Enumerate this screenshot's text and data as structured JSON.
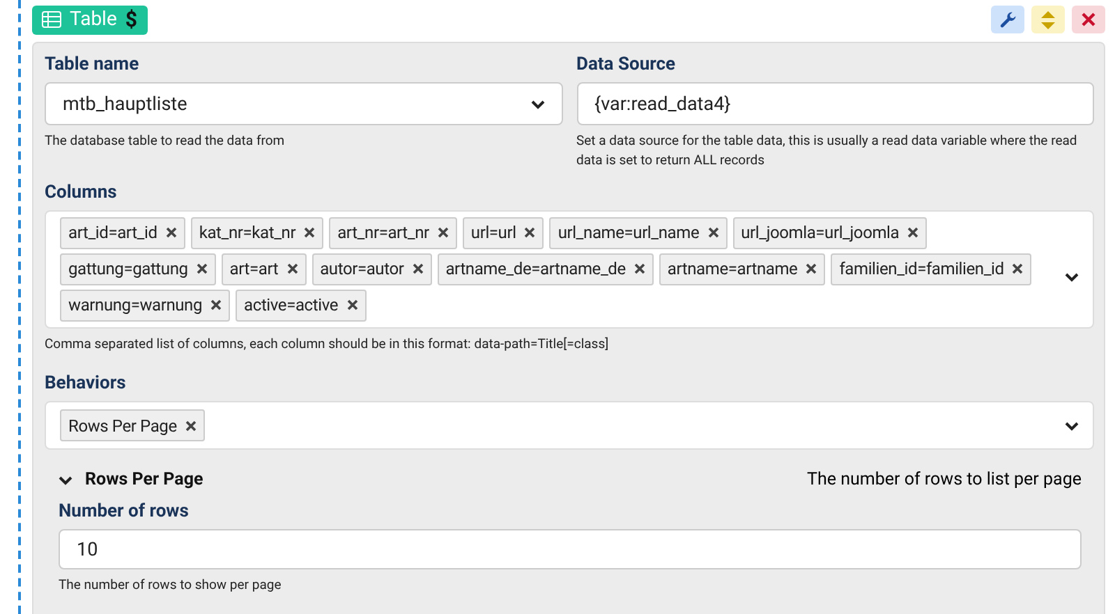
{
  "badge": {
    "title": "Table",
    "symbol": "$"
  },
  "actions": [
    {
      "kind": "settings"
    },
    {
      "kind": "move"
    },
    {
      "kind": "close"
    }
  ],
  "table_name": {
    "label": "Table name",
    "value": "mtb_hauptliste",
    "help": "The database table to read the data from"
  },
  "data_source": {
    "label": "Data Source",
    "value": "{var:read_data4}",
    "help": "Set a data source for the table data, this is usually a read data variable where the read data is set to return ALL records"
  },
  "columns": {
    "label": "Columns",
    "tags": [
      "art_id=art_id",
      "kat_nr=kat_nr",
      "art_nr=art_nr",
      "url=url",
      "url_name=url_name",
      "url_joomla=url_joomla",
      "gattung=gattung",
      "art=art",
      "autor=autor",
      "artname_de=artname_de",
      "artname=artname",
      "familien_id=familien_id",
      "warnung=warnung",
      "active=active"
    ],
    "help": "Comma separated list of columns, each column should be in this format: data-path=Title[=class]"
  },
  "behaviors": {
    "label": "Behaviors",
    "tags": [
      "Rows Per Page"
    ]
  },
  "section": {
    "title": "Rows Per Page",
    "expanded": true,
    "description": "The number of rows to list per page",
    "field": {
      "label": "Number of rows",
      "value": "10",
      "help": "The number of rows to show per page"
    }
  }
}
